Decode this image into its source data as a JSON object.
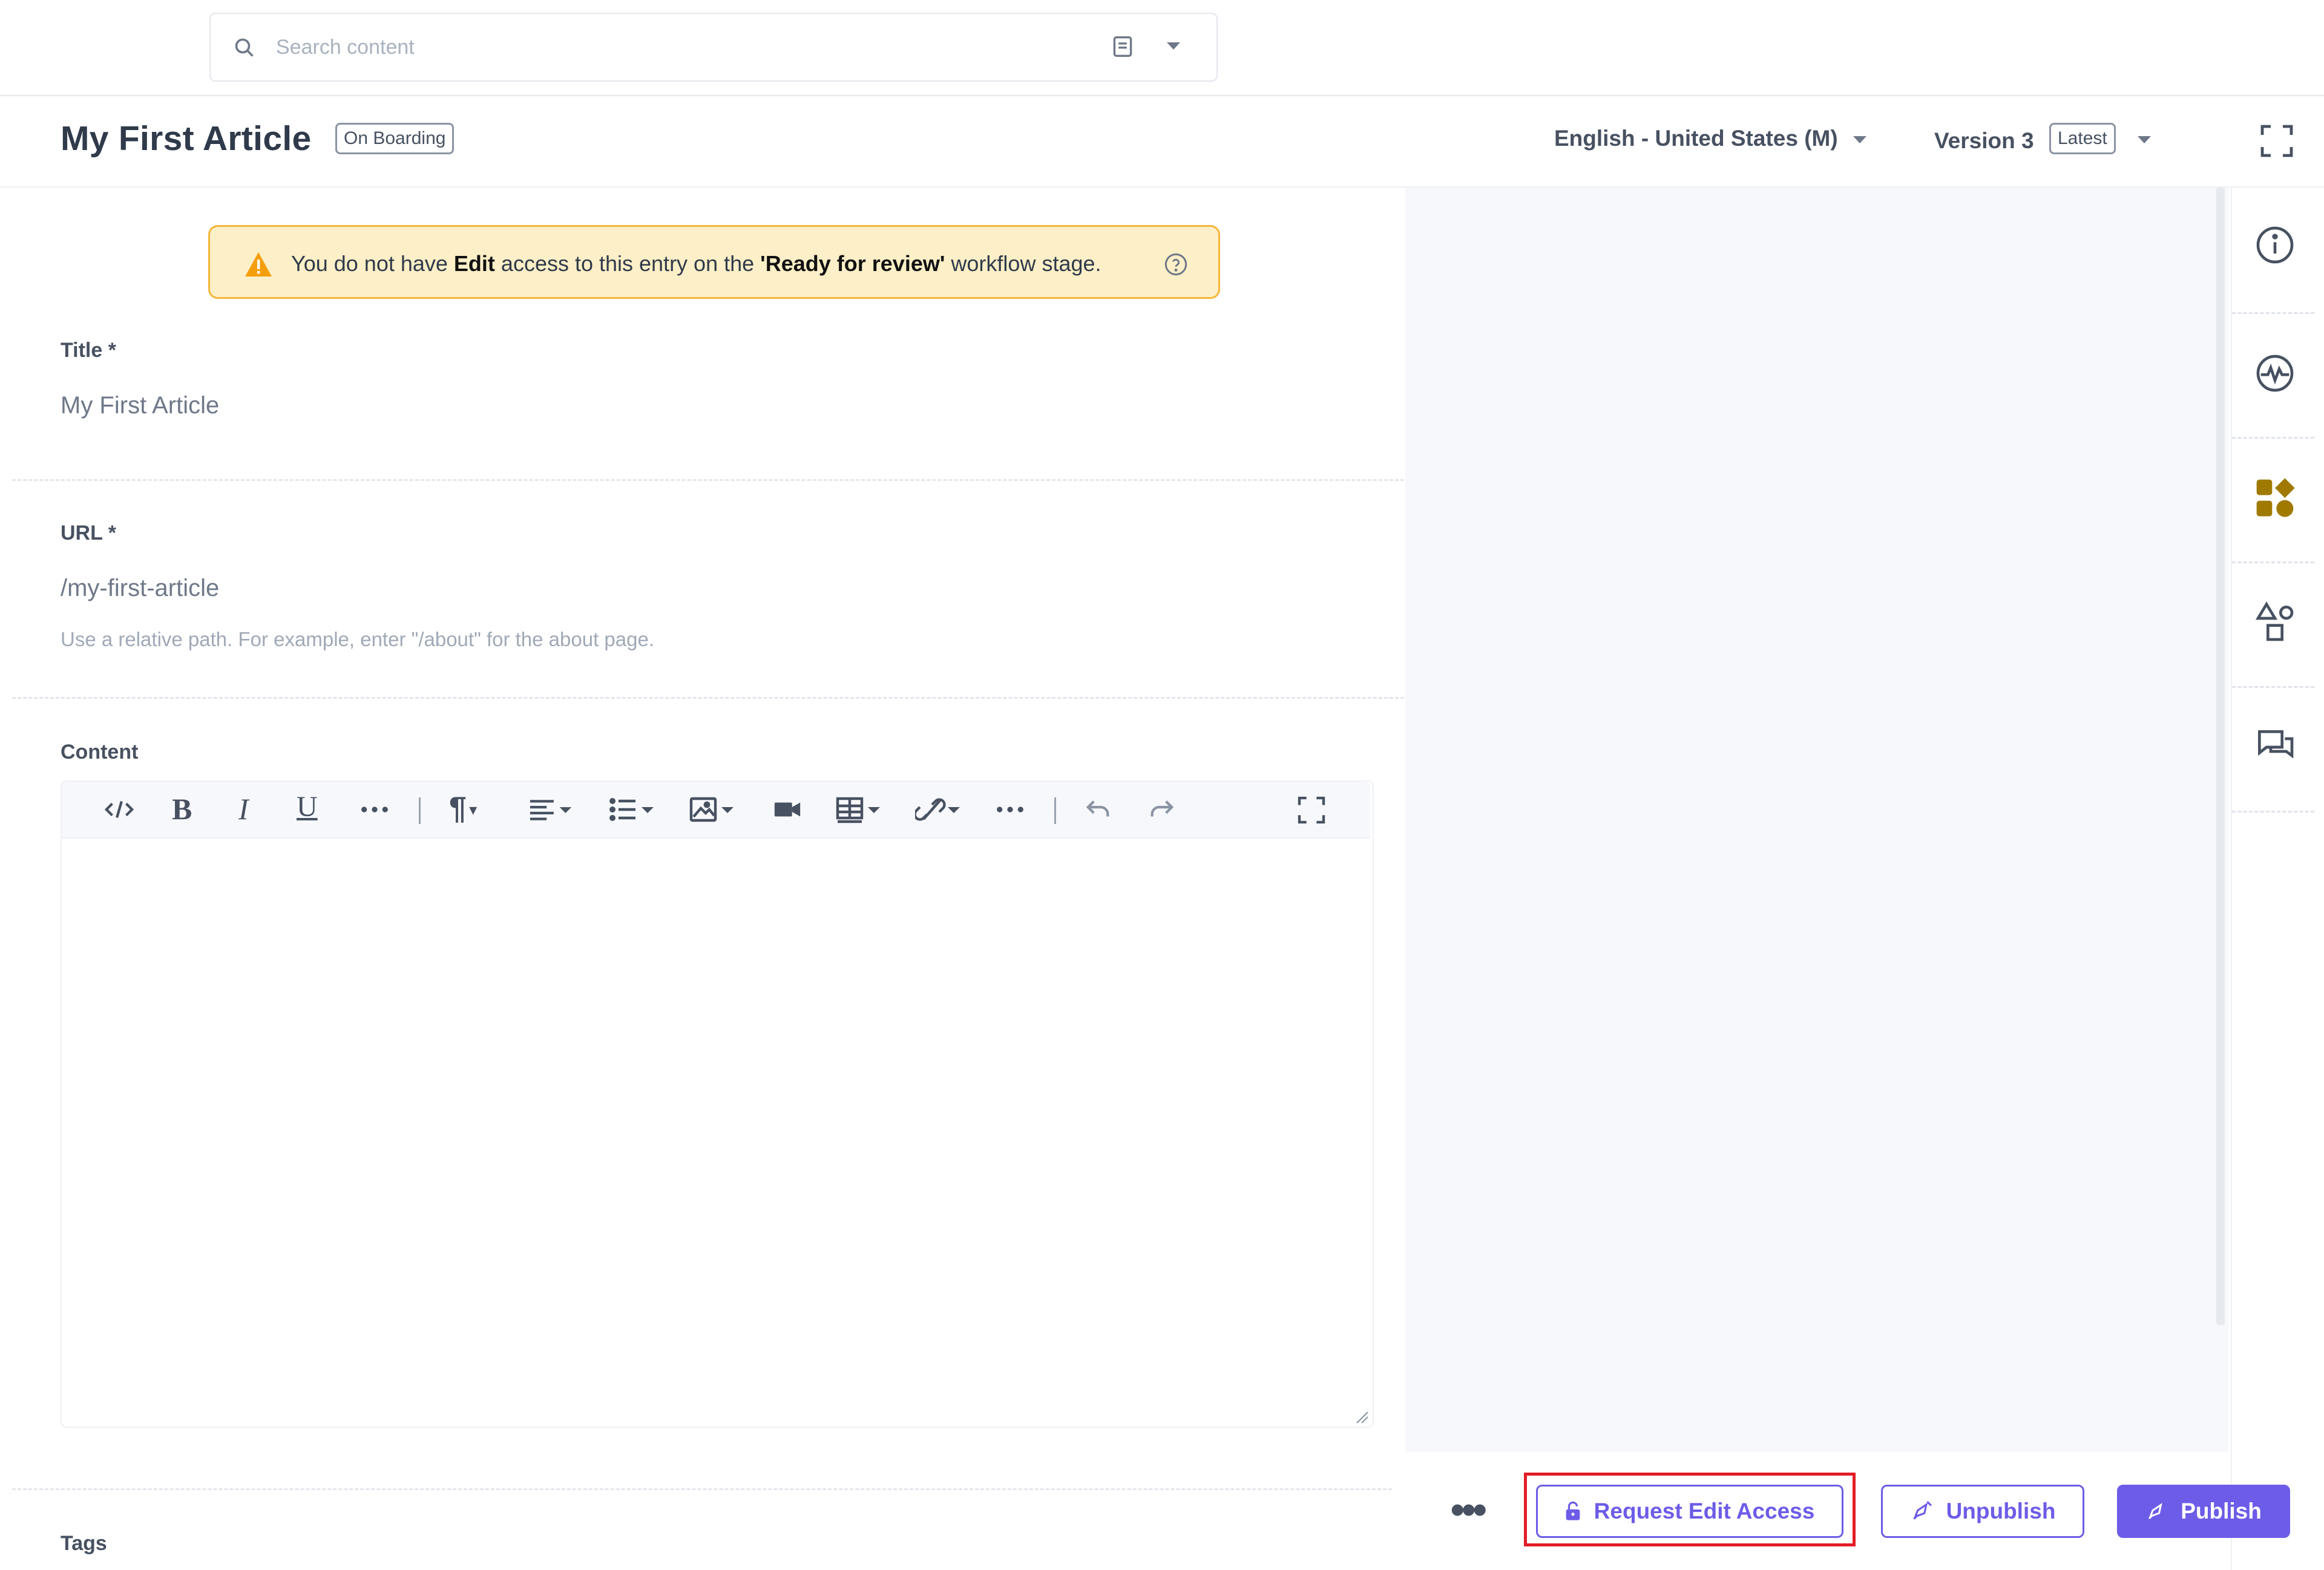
{
  "search": {
    "placeholder": "Search content"
  },
  "entry": {
    "title": "My First Article",
    "content_type": "On Boarding",
    "locale": "English - United States (M)",
    "version_label": "Version 3",
    "version_badge": "Latest"
  },
  "alert": {
    "part1": "You do not have ",
    "edit": "Edit",
    "part2": " access to this entry on the ",
    "stage": "'Ready for review'",
    "part3": " workflow stage."
  },
  "fields": {
    "title_label": "Title *",
    "title_value": "My First Article",
    "url_label": "URL *",
    "url_value": "/my-first-article",
    "url_hint": "Use a relative path. For example, enter \"/about\" for the about page.",
    "content_label": "Content",
    "tags_label": "Tags"
  },
  "toolbar_icons": [
    "code-icon",
    "bold-icon",
    "italic-icon",
    "underline-icon",
    "more-icon",
    "paragraph-icon",
    "align-icon",
    "list-icon",
    "image-icon",
    "video-icon",
    "table-icon",
    "link-icon",
    "more-icon",
    "undo-icon",
    "redo-icon",
    "fullscreen-icon"
  ],
  "sidebar_icons": [
    "info-icon",
    "activity-icon",
    "widgets-icon",
    "shapes-icon",
    "comments-icon"
  ],
  "actions": {
    "more": "•••",
    "request": "Request Edit Access",
    "unpublish": "Unpublish",
    "publish": "Publish"
  },
  "colors": {
    "accent": "#6c5ce7",
    "alert_bg": "#fdefc7",
    "alert_border": "#f5b63a",
    "highlight": "#e21d26",
    "widget_icon": "#a07a00"
  }
}
